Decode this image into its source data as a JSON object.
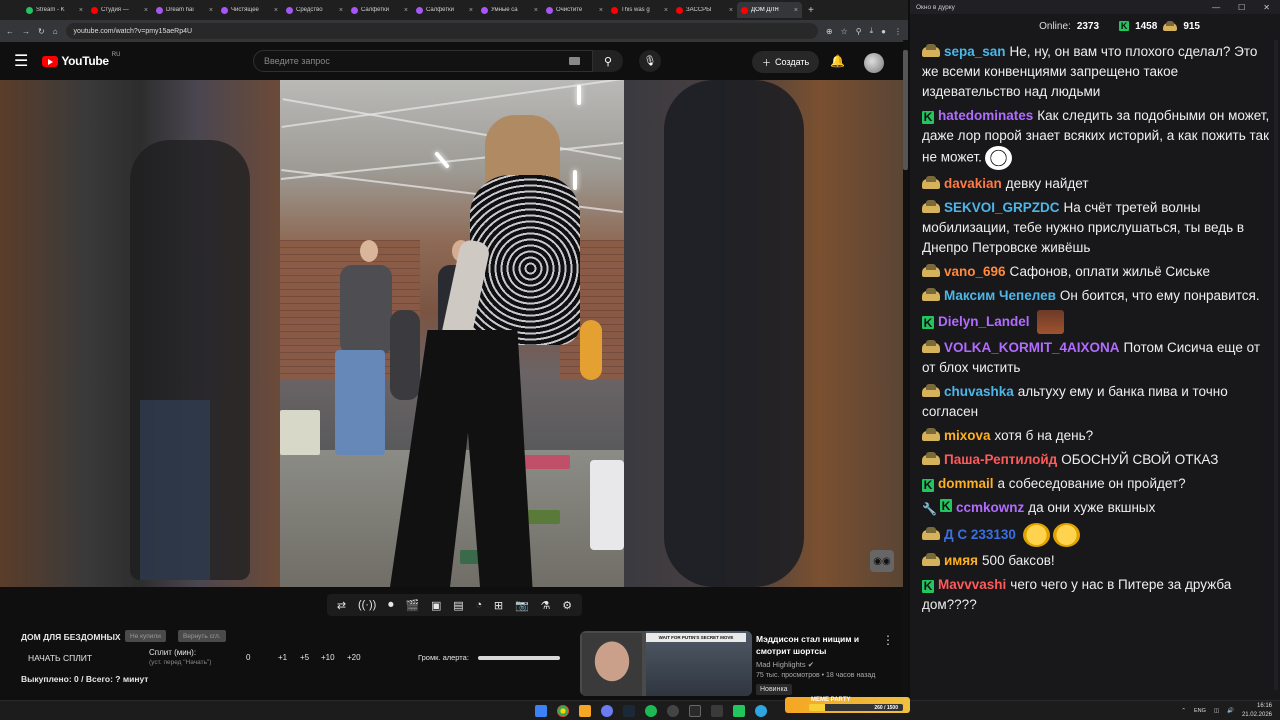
{
  "browser": {
    "tabs": [
      {
        "label": "Stream - K",
        "color": "#22c55e"
      },
      {
        "label": "Студия —",
        "color": "#ff0000"
      },
      {
        "label": "Dream hai",
        "color": "#a855f7"
      },
      {
        "label": "Чистящее",
        "color": "#a855f7"
      },
      {
        "label": "Средство",
        "color": "#a855f7"
      },
      {
        "label": "Салфетки",
        "color": "#a855f7"
      },
      {
        "label": "Салфетки",
        "color": "#a855f7"
      },
      {
        "label": "Умные са",
        "color": "#a855f7"
      },
      {
        "label": "Очистите",
        "color": "#a855f7"
      },
      {
        "label": "This was g",
        "color": "#ff0000"
      },
      {
        "label": "ЗАССРЫ",
        "color": "#ff0000"
      },
      {
        "label": "ДОМ ДЛЯ",
        "color": "#ff0000",
        "active": true
      }
    ],
    "url": "youtube.com/watch?v=pmy15aeRp4U"
  },
  "youtube": {
    "logo_text": "YouTube",
    "region": "RU",
    "search_placeholder": "Введите запрос",
    "create_label": "Создать"
  },
  "split_panel": {
    "video_title": "ДОМ ДЛЯ БЕЗДОМНЫХ",
    "pill_buy": "Не купили",
    "pill_return": "Вернуть сгл.",
    "start_label": "НАЧАТЬ СПЛИТ",
    "split_label": "Сплит (мин):",
    "split_hint": "(уст. перед \"Начать\")",
    "steps": [
      "0",
      "+1",
      "+5",
      "+10",
      "+20"
    ],
    "alert_label": "Громк. алерта:",
    "bought_label": "Выкуплено: 0 / Всего: ? минут"
  },
  "recommendation": {
    "thumb_banner": "WAIT FOR PUTIN'S SECRET MOVE",
    "title": "Мэддисон стал нищим и смотрит шортсы",
    "channel": "Mad Highlights",
    "meta": "75 тыс. просмотров • 18 часов назад",
    "badge": "Новинка"
  },
  "chat": {
    "window_title": "Окно в дурку",
    "online_label": "Online:",
    "online_count": "2373",
    "k_count": "1458",
    "bomj_count": "915",
    "messages": [
      {
        "badges": [
          "bomj"
        ],
        "nick": "sepa_san",
        "color": "#4db6e8",
        "text": "Не, ну, он вам что плохого сделал? Это же всеми конвенциями запрещено такое издевательство над людьми"
      },
      {
        "badges": [
          "k"
        ],
        "nick": "hatedominates",
        "color": "#b16cff",
        "text": "Как следить за подобными он может, даже лор порой знает всяких историй, а как пожить так не может.",
        "emote": "troll"
      },
      {
        "badges": [
          "bomj"
        ],
        "nick": "davakian",
        "color": "#ff7a45",
        "text": "девку найдет"
      },
      {
        "badges": [
          "bomj"
        ],
        "nick": "SEKVOI_GRPZDC",
        "color": "#4db6e8",
        "text": "На счёт третей волны мобилизации, тебе нужно прислушаться, ты ведь в Днепро Петровске живёшь"
      },
      {
        "badges": [
          "bomj"
        ],
        "nick": "vano_696",
        "color": "#ff8a3d",
        "text": "Сафонов, оплати жильё Сиське"
      },
      {
        "badges": [
          "bomj"
        ],
        "nick": "Максим Чепелев",
        "color": "#4db6e8",
        "text": "Он боится, что ему понравится."
      },
      {
        "badges": [
          "k"
        ],
        "nick": "Dielyn_Landel",
        "color": "#b16cff",
        "text": "",
        "emote": "man"
      },
      {
        "badges": [
          "bomj"
        ],
        "nick": "VOLKA_KORMIT_4AIXONA",
        "color": "#b16cff",
        "text": "Потом Сисича еще от от блох чистить"
      },
      {
        "badges": [
          "bomj"
        ],
        "nick": "chuvashka",
        "color": "#4db6e8",
        "text": "альтуху ему и банка пива и точно согласен"
      },
      {
        "badges": [
          "bomj"
        ],
        "nick": "mixova",
        "color": "#ffb020",
        "text": "хотя б на день?"
      },
      {
        "badges": [
          "bomj"
        ],
        "nick": "Паша-Рептилойд",
        "color": "#ff5a5a",
        "text": "ОБОСНУЙ СВОЙ ОТКАЗ"
      },
      {
        "badges": [
          "k"
        ],
        "nick": "dommail",
        "color": "#ffb020",
        "text": "а собеседование он пройдет?"
      },
      {
        "badges": [
          "pin",
          "k"
        ],
        "nick": "ccmkownz",
        "color": "#b16cff",
        "text": "да они хуже вкшных"
      },
      {
        "badges": [
          "bomj"
        ],
        "nick": "Д С 233130",
        "color": "#3b6fe0",
        "text": "",
        "emote": "lol2"
      },
      {
        "badges": [
          "bomj"
        ],
        "nick": "имяя",
        "color": "#ffb020",
        "text": "500 баксов!"
      },
      {
        "badges": [
          "k"
        ],
        "nick": "Mavvvashi",
        "color": "#ff5a5a",
        "text": "чего чего у нас в Питере за дружба дом????"
      }
    ]
  },
  "taskbar": {
    "meme_label": "MEME PARTY",
    "meme_progress_text": "260 / 1500",
    "meme_progress": 0.17,
    "lang": "ENG",
    "time": "16:16",
    "date": "21.02.2026"
  }
}
